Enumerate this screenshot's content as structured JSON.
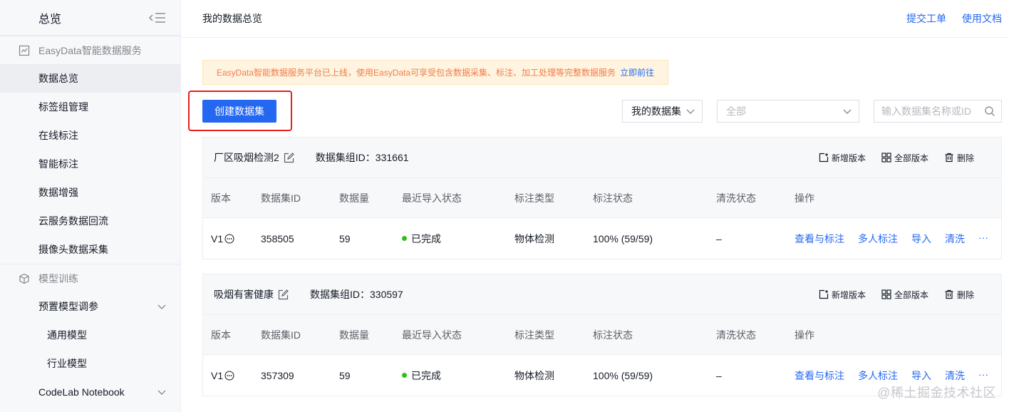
{
  "sidebar": {
    "title": "总览",
    "groups": [
      {
        "label": "EasyData智能数据服务",
        "items": [
          "数据总览",
          "标签组管理",
          "在线标注",
          "智能标注",
          "数据增强",
          "云服务数据回流",
          "摄像头数据采集"
        ]
      },
      {
        "label": "模型训练",
        "items": [
          "预置模型调参",
          "通用模型",
          "行业模型",
          "CodeLab Notebook"
        ]
      }
    ],
    "active": "数据总览"
  },
  "header": {
    "page_title": "我的数据总览",
    "links": [
      "提交工单",
      "使用文档"
    ]
  },
  "notice": {
    "text": "EasyData智能数据服务平台已上线，使用EasyData可享受包含数据采集、标注、加工处理等完整数据服务",
    "link": "立即前往"
  },
  "toolbar": {
    "create_label": "创建数据集",
    "filter_scope": "我的数据集",
    "filter_type_placeholder": "全部",
    "search_placeholder": "输入数据集名称或ID"
  },
  "card_actions": [
    "新增版本",
    "全部版本",
    "删除"
  ],
  "table_columns": [
    "版本",
    "数据集ID",
    "数据量",
    "最近导入状态",
    "标注类型",
    "标注状态",
    "清洗状态",
    "操作"
  ],
  "row_ops": [
    "查看与标注",
    "多人标注",
    "导入",
    "清洗",
    "···"
  ],
  "datasets": [
    {
      "name": "厂区吸烟检测2",
      "group_id_label": "数据集组ID：331661",
      "row": {
        "version": "V1",
        "id": "358505",
        "count": "59",
        "import_status": "已完成",
        "label_type": "物体检测",
        "label_status": "100% (59/59)",
        "clean_status": "–"
      }
    },
    {
      "name": "吸烟有害健康",
      "group_id_label": "数据集组ID：330597",
      "row": {
        "version": "V1",
        "id": "357309",
        "count": "59",
        "import_status": "已完成",
        "label_type": "物体检测",
        "label_status": "100% (59/59)",
        "clean_status": "–"
      }
    }
  ],
  "watermark": "@稀土掘金技术社区",
  "colors": {
    "accent": "#2468f2",
    "notice_text": "#f27c49",
    "notice_bg": "#fff4e0",
    "highlight": "#e5201e",
    "status_ok": "#30bf13"
  }
}
